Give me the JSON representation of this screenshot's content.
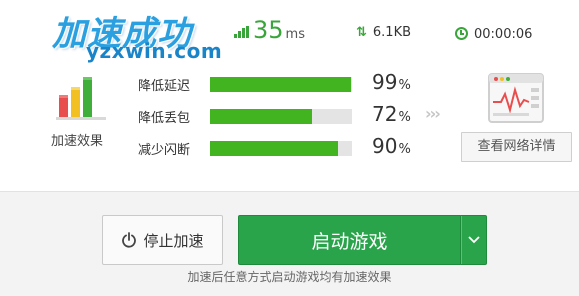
{
  "header": {
    "title": "加速成功",
    "watermark": "yzxwin.com"
  },
  "stats": {
    "ping_value": "35",
    "ping_unit": "ms",
    "speed": "6.1KB",
    "elapsed": "00:00:06"
  },
  "effect": {
    "label": "加速效果"
  },
  "metrics": [
    {
      "label": "降低延迟",
      "value": "99",
      "unit": "%",
      "fill": 0.99
    },
    {
      "label": "降低丢包",
      "value": "72",
      "unit": "%",
      "fill": 0.72
    },
    {
      "label": "减少闪断",
      "value": "90",
      "unit": "%",
      "fill": 0.9
    }
  ],
  "arrows": "›››",
  "network": {
    "detail_label": "查看网络详情"
  },
  "actions": {
    "stop_label": "停止加速",
    "start_label": "启动游戏",
    "hint": "加速后任意方式启动游戏均有加速效果"
  },
  "colors": {
    "accent_green": "#41b41f",
    "button_green": "#2aa44b",
    "title_blue": "#2aa0e0"
  }
}
